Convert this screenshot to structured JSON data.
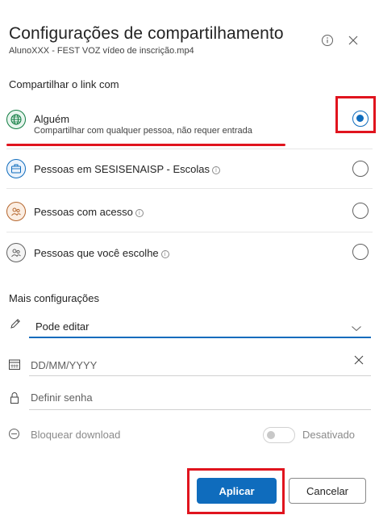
{
  "dialog": {
    "title": "Configurações de compartilhamento",
    "subtitle": "AlunoXXX - FEST VOZ vídeo de inscrição.mp4",
    "info_icon": "info-icon",
    "close_icon": "close-icon"
  },
  "share_section": {
    "label": "Compartilhar o link com",
    "options": [
      {
        "title": "Alguém",
        "description": "Compartilhar com qualquer pessoa, não requer entrada",
        "icon": "globe-icon",
        "selected": true,
        "has_info": false
      },
      {
        "title": "Pessoas em SESISENAISP - Escolas",
        "description": "",
        "icon": "briefcase-icon",
        "selected": false,
        "has_info": true
      },
      {
        "title": "Pessoas com acesso",
        "description": "",
        "icon": "people-icon",
        "selected": false,
        "has_info": true
      },
      {
        "title": "Pessoas que você escolhe",
        "description": "",
        "icon": "people-icon",
        "selected": false,
        "has_info": true
      }
    ]
  },
  "more_section": {
    "label": "Mais configurações",
    "permission": {
      "value": "Pode editar",
      "icon": "pencil-icon",
      "dropdown_icon": "chevron-down-icon"
    },
    "expiry": {
      "placeholder": "DD/MM/YYYY",
      "icon": "calendar-icon",
      "clear_icon": "close-icon"
    },
    "password": {
      "placeholder": "Definir senha",
      "icon": "lock-icon"
    },
    "block_download": {
      "label": "Bloquear download",
      "icon": "block-icon",
      "toggle_state": "Desativado",
      "enabled": false
    }
  },
  "buttons": {
    "apply": "Aplicar",
    "cancel": "Cancelar"
  },
  "colors": {
    "accent": "#0f6cbd",
    "annotation_red": "#e0141e",
    "globe": "#107c41",
    "briefcase": "#0f6cbd",
    "people_access": "#b5662d",
    "people_choose": "#616161"
  }
}
